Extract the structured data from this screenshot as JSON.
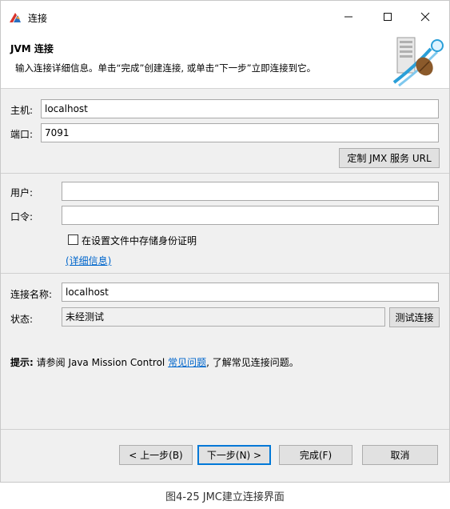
{
  "window": {
    "title": "连接"
  },
  "banner": {
    "title": "JVM 连接",
    "description": "输入连接详细信息。单击“完成”创建连接, 或单击“下一步”立即连接到它。"
  },
  "host": {
    "label": "主机:",
    "value": "localhost"
  },
  "port": {
    "label": "端口:",
    "value": "7091"
  },
  "jmx_url_button": "定制 JMX 服务 URL",
  "user": {
    "label": "用户:",
    "value": ""
  },
  "password": {
    "label": "口令:",
    "value": ""
  },
  "store_credentials": {
    "label": "在设置文件中存储身份证明",
    "checked": false
  },
  "details_link": "(详细信息)",
  "connection_name": {
    "label": "连接名称:",
    "value": "localhost"
  },
  "status": {
    "label": "状态:",
    "value": "未经测试"
  },
  "test_button": "测试连接",
  "hint": {
    "prefix": "提示:",
    "text_before": " 请参阅 Java Mission Control ",
    "link": "常见问题",
    "text_after": ", 了解常见连接问题。"
  },
  "buttons": {
    "back": "< 上一步(B)",
    "next": "下一步(N) >",
    "finish": "完成(F)",
    "cancel": "取消"
  },
  "caption": "图4-25 JMC建立连接界面",
  "icons": {
    "app": "jmc-app-icon",
    "banner": "connection-plug-icon"
  }
}
